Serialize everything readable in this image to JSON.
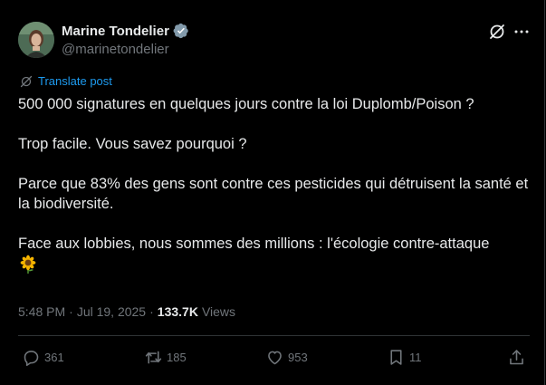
{
  "author": {
    "display_name": "Marine Tondelier",
    "handle": "@marinetondelier",
    "verified": true
  },
  "translate_label": "Translate post",
  "tweet": {
    "paragraphs": [
      "500 000 signatures en quelques jours contre la loi Duplomb/Poison ?",
      "Trop facile. Vous savez pourquoi ?",
      "Parce que 83% des gens sont contre ces pesticides qui détruisent la santé et la biodiversité.",
      "Face aux lobbies, nous sommes des millions : l'écologie contre-attaque"
    ],
    "emoji": "sunflower"
  },
  "meta": {
    "time": "5:48 PM",
    "separator1": "·",
    "date": "Jul 19, 2025",
    "separator2": "·",
    "views_count": "133.7K",
    "views_label": "Views"
  },
  "actions": {
    "replies": "361",
    "reposts": "185",
    "likes": "953",
    "bookmarks": "11"
  },
  "colors": {
    "background": "#000000",
    "text": "#e7e9ea",
    "secondary": "#71767b",
    "link": "#1d9bf0",
    "verified": "#829aab",
    "divider": "#2f3336"
  },
  "icons": {
    "verified": "verified-badge-icon",
    "grok": "grok-icon",
    "more": "more-icon",
    "translate": "translate-icon",
    "reply": "reply-icon",
    "repost": "repost-icon",
    "like": "like-icon",
    "bookmark": "bookmark-icon",
    "share": "share-icon"
  }
}
